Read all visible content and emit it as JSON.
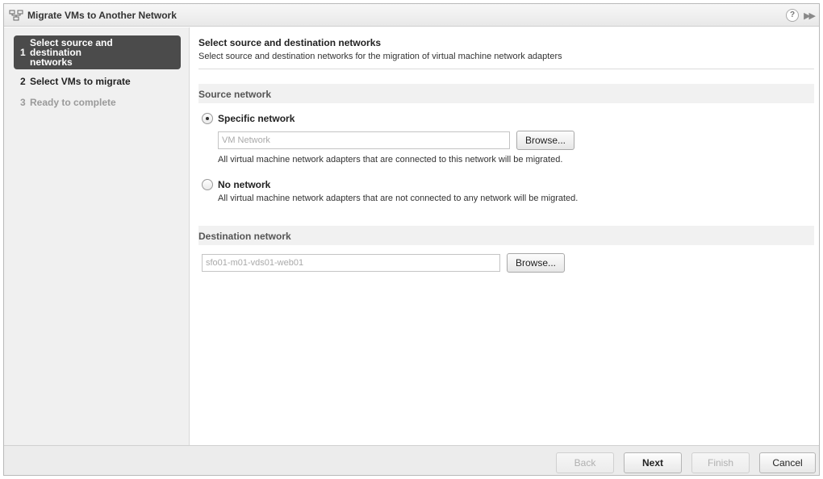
{
  "window": {
    "title": "Migrate VMs to Another Network",
    "title_icon": "network-migrate-icon",
    "help_icon": "help-icon",
    "expand_icon": "expand-icon"
  },
  "sidebar": {
    "steps": [
      {
        "number": "1",
        "label": "Select source and destination networks",
        "state": "active"
      },
      {
        "number": "2",
        "label": "Select VMs to migrate",
        "state": "normal"
      },
      {
        "number": "3",
        "label": "Ready to complete",
        "state": "disabled"
      }
    ]
  },
  "content": {
    "title": "Select source and destination networks",
    "description": "Select source and destination networks for the migration of virtual machine network adapters",
    "source": {
      "heading": "Source network",
      "specific_label": "Specific network",
      "specific_selected": true,
      "network_placeholder": "VM Network",
      "browse_label": "Browse...",
      "specific_help": "All virtual machine network adapters that are connected to this network will be migrated.",
      "no_network_label": "No network",
      "no_network_help": "All virtual machine network adapters that are not connected to any network will be migrated."
    },
    "destination": {
      "heading": "Destination network",
      "network_placeholder": "sfo01-m01-vds01-web01",
      "browse_label": "Browse..."
    }
  },
  "footer": {
    "back_label": "Back",
    "next_label": "Next",
    "finish_label": "Finish",
    "cancel_label": "Cancel"
  }
}
